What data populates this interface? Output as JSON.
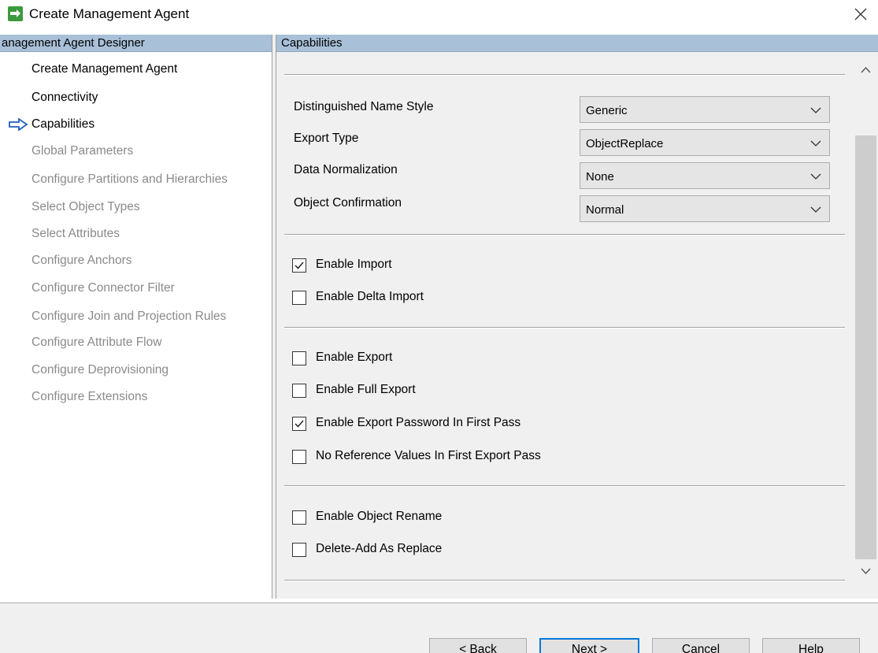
{
  "window": {
    "title": "Create Management Agent",
    "close_icon": "close-icon"
  },
  "left_panel": {
    "header": "anagement Agent Designer",
    "items": [
      {
        "label": "Create Management Agent",
        "state": "completed"
      },
      {
        "label": "Connectivity",
        "state": "completed"
      },
      {
        "label": "Capabilities",
        "state": "current"
      },
      {
        "label": "Global Parameters",
        "state": "disabled"
      },
      {
        "label": "Configure Partitions and Hierarchies",
        "state": "disabled"
      },
      {
        "label": "Select Object Types",
        "state": "disabled"
      },
      {
        "label": "Select Attributes",
        "state": "disabled"
      },
      {
        "label": "Configure Anchors",
        "state": "disabled"
      },
      {
        "label": "Configure Connector Filter",
        "state": "disabled"
      },
      {
        "label": "Configure Join and Projection Rules",
        "state": "disabled"
      },
      {
        "label": "Configure Attribute Flow",
        "state": "disabled"
      },
      {
        "label": "Configure Deprovisioning",
        "state": "disabled"
      },
      {
        "label": "Configure Extensions",
        "state": "disabled"
      }
    ]
  },
  "right_panel": {
    "header": "Capabilities",
    "dropdowns": [
      {
        "label": "Distinguished Name Style",
        "value": "Generic"
      },
      {
        "label": "Export Type",
        "value": "ObjectReplace"
      },
      {
        "label": "Data Normalization",
        "value": "None"
      },
      {
        "label": "Object Confirmation",
        "value": "Normal"
      }
    ],
    "checkbox_groups": [
      [
        {
          "label": "Enable Import",
          "checked": true
        },
        {
          "label": "Enable Delta Import",
          "checked": false
        }
      ],
      [
        {
          "label": "Enable Export",
          "checked": false
        },
        {
          "label": "Enable Full Export",
          "checked": false
        },
        {
          "label": "Enable Export Password In First Pass",
          "checked": true
        },
        {
          "label": "No Reference Values In First Export Pass",
          "checked": false
        }
      ],
      [
        {
          "label": "Enable Object Rename",
          "checked": false
        },
        {
          "label": "Delete-Add As Replace",
          "checked": false
        }
      ]
    ]
  },
  "buttons": {
    "back": "< Back",
    "next": "Next >",
    "cancel": "Cancel",
    "help": "Help"
  },
  "colors": {
    "header_bg": "#a8c0d8",
    "current_arrow": "#1f5fbf",
    "disabled_text": "#8a8a8a",
    "default_button_border": "#0078d7"
  }
}
